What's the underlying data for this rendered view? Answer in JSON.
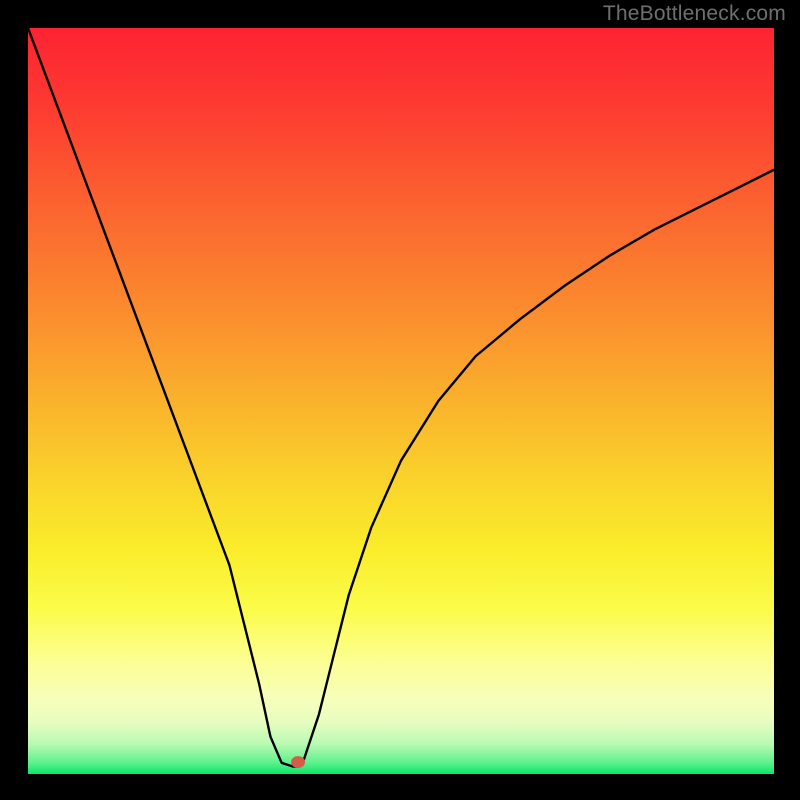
{
  "watermark": "TheBottleneck.com",
  "chart_data": {
    "type": "line",
    "title": "",
    "xlabel": "",
    "ylabel": "",
    "xlim": [
      0,
      100
    ],
    "ylim": [
      0,
      100
    ],
    "background_gradient": {
      "orientation": "vertical",
      "stops": [
        {
          "offset": 0.0,
          "color": "#fd2332"
        },
        {
          "offset": 0.1,
          "color": "#fd3931"
        },
        {
          "offset": 0.2,
          "color": "#fc5830"
        },
        {
          "offset": 0.3,
          "color": "#fb752f"
        },
        {
          "offset": 0.4,
          "color": "#fb922e"
        },
        {
          "offset": 0.5,
          "color": "#fab22c"
        },
        {
          "offset": 0.6,
          "color": "#fad12b"
        },
        {
          "offset": 0.7,
          "color": "#faed2b"
        },
        {
          "offset": 0.78,
          "color": "#fbfc4a"
        },
        {
          "offset": 0.85,
          "color": "#fcfe94"
        },
        {
          "offset": 0.9,
          "color": "#f7feba"
        },
        {
          "offset": 0.93,
          "color": "#e7fdc0"
        },
        {
          "offset": 0.96,
          "color": "#b8fab2"
        },
        {
          "offset": 0.985,
          "color": "#5ef18d"
        },
        {
          "offset": 1.0,
          "color": "#06e768"
        }
      ]
    },
    "series": [
      {
        "name": "bottleneck-curve",
        "color": "#000000",
        "x": [
          0,
          3,
          6,
          9,
          12,
          15,
          18,
          21,
          24,
          27,
          29,
          31,
          32.5,
          34,
          35.5,
          36.2,
          37,
          39,
          41,
          43,
          46,
          50,
          55,
          60,
          66,
          72,
          78,
          84,
          90,
          95,
          100
        ],
        "values": [
          100,
          92,
          84,
          76,
          68,
          60,
          52,
          44,
          36,
          28,
          20,
          12,
          5,
          1.5,
          1,
          1,
          2,
          8,
          16,
          24,
          33,
          42,
          50,
          56,
          61,
          65.5,
          69.5,
          73,
          76,
          78.5,
          81
        ]
      }
    ],
    "marker": {
      "name": "optimal-point",
      "x": 36.2,
      "y": 1.6,
      "color": "#d35d49",
      "radius_px": 7
    }
  }
}
